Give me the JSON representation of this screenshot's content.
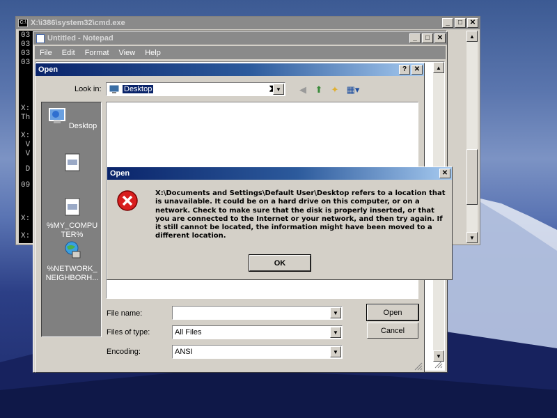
{
  "cmd": {
    "title": "X:\\i386\\system32\\cmd.exe",
    "lines": [
      "03",
      "03",
      "03",
      "03",
      "",
      "",
      "",
      "X:",
      "Th",
      "",
      "X:",
      " V",
      " V",
      "",
      " D",
      "",
      "09",
      "",
      "",
      "",
      "X:",
      "",
      "X:",
      "",
      "X:"
    ]
  },
  "notepad": {
    "title": "Untitled - Notepad",
    "menu": [
      "File",
      "Edit",
      "Format",
      "View",
      "Help"
    ]
  },
  "open_dialog": {
    "title": "Open",
    "help_btn": "?",
    "look_in_label": "Look in:",
    "look_in_value": "Desktop",
    "places": [
      {
        "label": "Desktop",
        "icon": "desktop-icon"
      },
      {
        "label": "",
        "icon": "document-icon"
      },
      {
        "label": "%MY_COMPUTER%",
        "icon": "my-computer-icon"
      },
      {
        "label": "%NETWORK_NEIGHBORH...",
        "icon": "network-icon"
      }
    ],
    "file_name_label": "File name:",
    "file_name_value": "",
    "file_type_label": "Files of type:",
    "file_type_value": "All Files",
    "encoding_label": "Encoding:",
    "encoding_value": "ANSI",
    "open_btn": "Open",
    "cancel_btn": "Cancel"
  },
  "error_dialog": {
    "title": "Open",
    "message": "X:\\Documents and Settings\\Default User\\Desktop refers to a location that is unavailable. It could be on a hard drive on this computer, or on a network. Check to make sure that the disk is properly inserted, or that you are connected to the Internet or your network, and then try again. If it still cannot be located, the information might have been moved to a different location.",
    "ok_btn": "OK",
    "icon": "error-icon"
  },
  "window_buttons": {
    "minimize": "_",
    "maximize": "□",
    "close": "✕"
  }
}
